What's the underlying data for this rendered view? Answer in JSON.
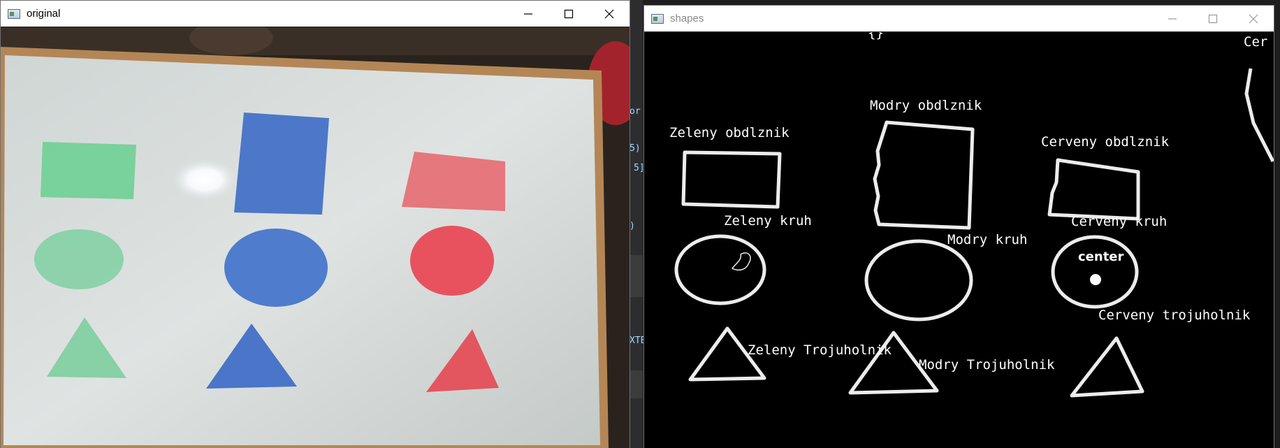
{
  "windows": {
    "original": {
      "title": "original"
    },
    "shapes": {
      "title": "shapes"
    }
  },
  "background": {
    "fragments": [
      "or",
      "5)",
      "5]",
      ")",
      "XTE"
    ],
    "status_text": "...."
  },
  "shapes": {
    "labels": {
      "green_rect": "Zeleny obdlznik",
      "blue_rect": "Modry obdlznik",
      "red_rect": "Cerveny obdlznik",
      "green_circle": "Zeleny kruh",
      "blue_circle": "Modry kruh",
      "red_circle": "Cerveny kruh",
      "green_tri": "Zeleny Trojuholnik",
      "blue_tri": "Modry Trojuholnik",
      "red_tri": "Cerveny trojuholnik",
      "center": "center",
      "partial_top": "Cer",
      "top_brace": "{}"
    }
  },
  "colors": {
    "green": "#5fcf8a",
    "blue": "#4a74c9",
    "red": "#e8525f",
    "board": "#d9dedd",
    "frame": "#b78a55"
  },
  "icons": {
    "window_minimize": "minimize-icon",
    "window_maximize": "maximize-icon",
    "window_close": "close-icon",
    "app": "app-icon"
  }
}
